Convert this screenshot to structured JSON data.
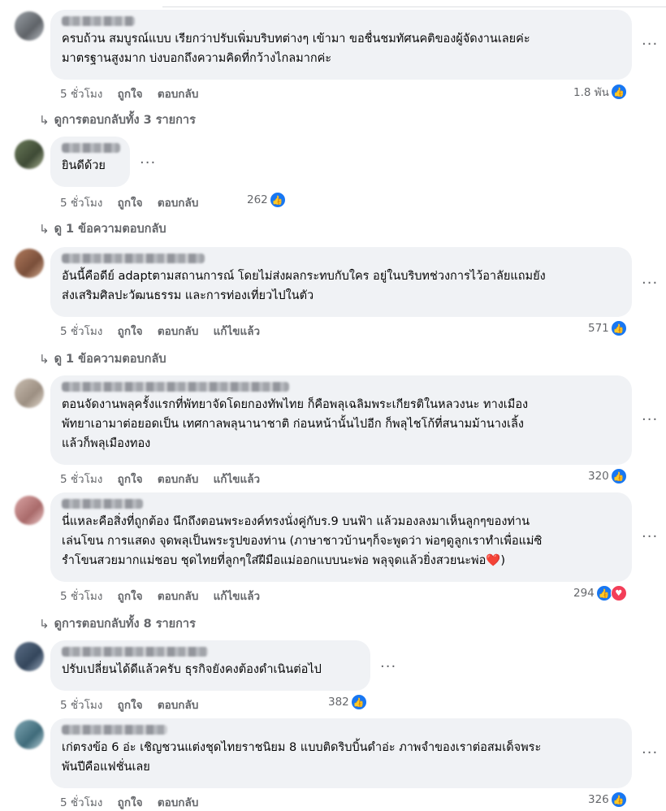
{
  "comments": [
    {
      "text": "ครบถ้วน สมบูรณ์แบบ เรียกว่าปรับเพิ่มบริบทต่างๆ เข้ามา ขอชื่นชมทัศนคติของผู้จัดงานเลยค่ะ\nมาตรฐานสูงมาก บ่งบอกถึงความคิดที่กว้างไกลมากค่ะ",
      "time": "5 ชั่วโมง",
      "like": "ถูกใจ",
      "reply": "ตอบกลับ",
      "edited": "",
      "reaction_count": "1.8 พัน",
      "replies_link": "ดูการตอบกลับทั้ง 3 รายการ"
    },
    {
      "text": "ยินดีด้วย",
      "time": "5 ชั่วโมง",
      "like": "ถูกใจ",
      "reply": "ตอบกลับ",
      "edited": "",
      "reaction_count": "262",
      "replies_link": "ดู 1 ข้อความตอบกลับ"
    },
    {
      "text": "อันนี้คือดีย์ adaptตามสถานการณ์ โดยไม่ส่งผลกระทบกับใคร อยู่ในบริบทช่วงการไว้อาลัยแถมยัง\nส่งเสริมศิลปะวัฒนธรรม และการท่องเที่ยวไปในตัว",
      "time": "5 ชั่วโมง",
      "like": "ถูกใจ",
      "reply": "ตอบกลับ",
      "edited": "แก้ไขแล้ว",
      "reaction_count": "571",
      "replies_link": "ดู 1 ข้อความตอบกลับ"
    },
    {
      "text": "ตอนจัดงานพลุครั้งแรกที่พัทยาจัดโดยกองทัพไทย ก็คือพลุเฉลิมพระเกียรติในหลวงนะ ทางเมือง\nพัทยาเอามาต่อยอดเป็น เทศกาลพลุนานาชาติ ก่อนหน้านั้นไปอีก ก็พลุไชโก้ที่สนามม้านางเลิ้ง\nแล้วก็พลุเมืองทอง",
      "time": "5 ชั่วโมง",
      "like": "ถูกใจ",
      "reply": "ตอบกลับ",
      "edited": "แก้ไขแล้ว",
      "reaction_count": "320",
      "replies_link": ""
    },
    {
      "text": "นี่แหละคือสิ่งที่ถูกต้อง นึกถึงตอนพระองค์ทรงนั่งคู่กับร.9 บนฟ้า แล้วมองลงมาเห็นลูกๆของท่าน\nเล่นโขน การแสดง จุดพลุเป็นพระรูปของท่าน (ภาษาชาวบ้านๆก็จะพูดว่า พ่อๆดูลูกเราทำเพื่อแม่ซิ\nรำโขนสวยมากแม่ชอบ ชุดไทยที่ลูกๆใส่ฝีมือแม่ออกแบบนะพ่อ พลุจุดแล้วยิ่งสวยนะพ่อ",
      "heart": "❤️",
      "tail": ")",
      "time": "5 ชั่วโมง",
      "like": "ถูกใจ",
      "reply": "ตอบกลับ",
      "edited": "แก้ไขแล้ว",
      "reaction_count": "294",
      "replies_link": "ดูการตอบกลับทั้ง 8 รายการ"
    },
    {
      "text": "ปรับเปลี่ยนได้ดีแล้วครับ ธุรกิจยังคงต้องดำเนินต่อไป",
      "time": "5 ชั่วโมง",
      "like": "ถูกใจ",
      "reply": "ตอบกลับ",
      "edited": "",
      "reaction_count": "382",
      "replies_link": ""
    },
    {
      "text": "เก่ตรงข้อ 6 อ่ะ เชิญชวนแต่งชุดไทยราชนิยม 8 แบบติดริบบิ้นดำอ่ะ ภาพจำของเราต่อสมเด็จพระ\nพันปีคือแฟชั่นเลย",
      "time": "5 ชั่วโมง",
      "like": "ถูกใจ",
      "reply": "ตอบกลับ",
      "edited": "",
      "reaction_count": "326",
      "replies_link": ""
    }
  ],
  "icons": {
    "more": "more-dots-icon",
    "like": "like-reaction-icon",
    "love": "love-reaction-icon",
    "reply_arrow": "reply-arrow-icon"
  },
  "colors": {
    "bubble": "#f0f2f5",
    "like_blue": "#1877f2",
    "love_red": "#f33e58",
    "meta_gray": "#65676b"
  }
}
